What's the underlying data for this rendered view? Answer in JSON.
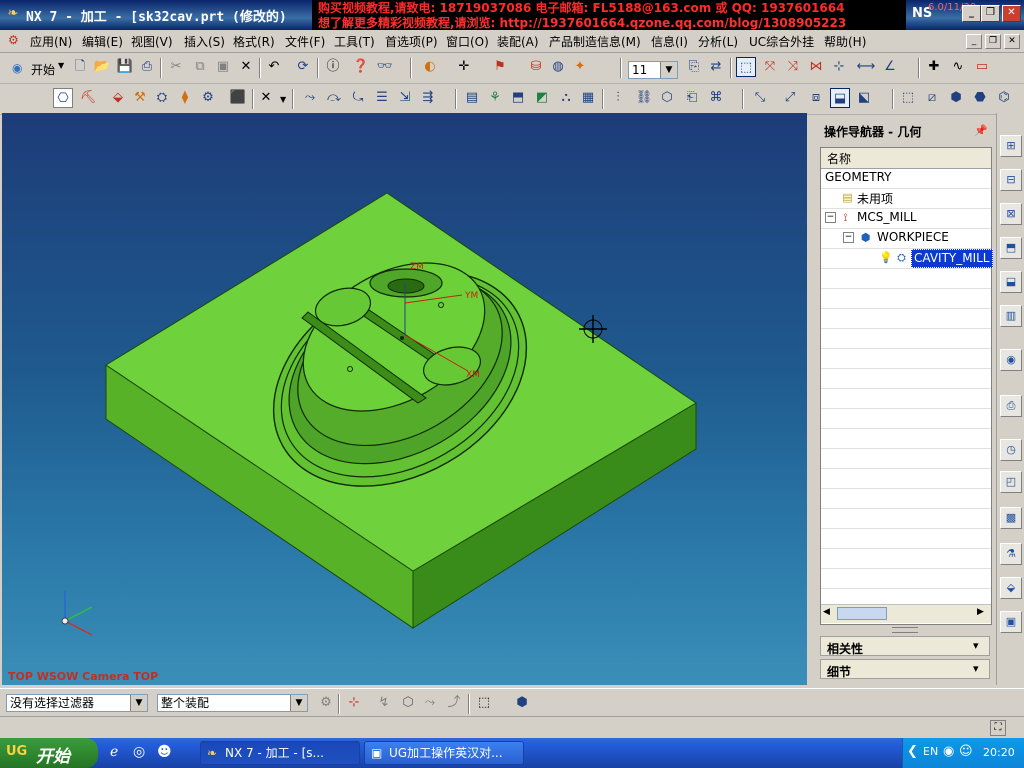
{
  "window": {
    "title": "NX 7 - 加工 - [sk32cav.prt  (修改的)",
    "ad_line1": "购买视频教程,请致电:  18719037086  电子邮箱:  FL5188@163.com 或 QQ:  1937601664",
    "ad_line2": "想了解更多精彩视频教程,请浏览:  http://1937601664.qzone.qq.com/blog/1308905223",
    "brand": "NS",
    "version": "6.0/11/30"
  },
  "menu": [
    "应用(N)",
    "编辑(E)",
    "视图(V)",
    "插入(S)",
    "格式(R)",
    "文件(F)",
    "工具(T)",
    "首选项(P)",
    "窗口(O)",
    "装配(A)",
    "产品制造信息(M)",
    "信息(I)",
    "分析(L)",
    "UC综合外挂",
    "帮助(H)"
  ],
  "toolbar": {
    "start_label": "开始",
    "layer_value": "11"
  },
  "viewport": {
    "view_label": "TOP WSOW Camera TOP",
    "axes": {
      "zm": "ZM",
      "ym": "YM",
      "xm": "XM"
    }
  },
  "navigator": {
    "title": "操作导航器 - 几何",
    "column_header": "名称",
    "rows": [
      {
        "label": "GEOMETRY",
        "icon": "",
        "indent": 0
      },
      {
        "label": "未用项",
        "icon": "folder-icon",
        "indent": 1
      },
      {
        "label": "MCS_MILL",
        "icon": "mcs-icon",
        "indent": 1
      },
      {
        "label": "WORKPIECE",
        "icon": "workpiece-icon",
        "indent": 2
      },
      {
        "label": "CAVITY_MILL",
        "icon": "cavity-mill-icon",
        "indent": 3
      }
    ],
    "relations_label": "相关性",
    "details_label": "细节"
  },
  "selection_bar": {
    "filter_value": "没有选择过滤器",
    "scope_value": "整个装配"
  },
  "taskbar": {
    "start_label": "开始",
    "tasks": [
      "NX 7 - 加工 - [s...",
      "UG加工操作英汉对..."
    ],
    "clock": "20:20"
  },
  "colors": {
    "part_green": "#6fd23c",
    "viewport_top": "#1d3c78",
    "viewport_bottom": "#3a8fb8",
    "highlight": "#0a3ad0"
  }
}
